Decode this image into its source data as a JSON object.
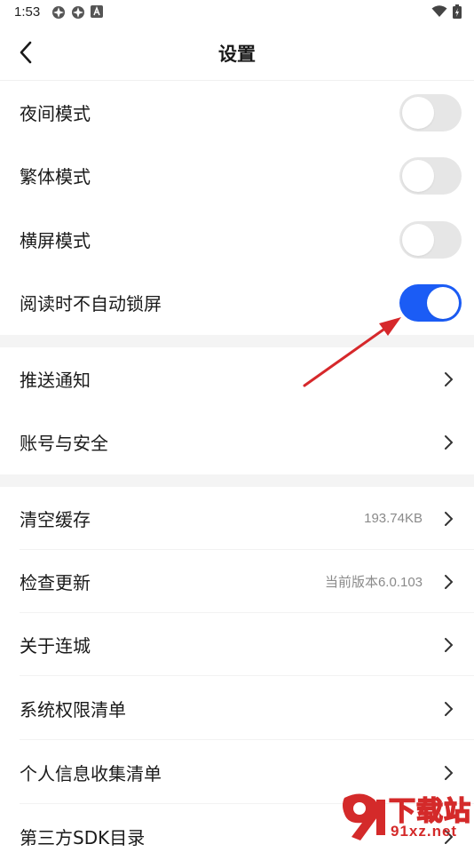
{
  "status_bar": {
    "time": "1:53",
    "left_icons": [
      "app-notification-icon",
      "app-notification-icon",
      "text-icon"
    ],
    "right_icons": [
      "wifi-icon",
      "battery-charging-icon"
    ]
  },
  "header": {
    "title": "设置",
    "back_icon": "chevron-left-icon"
  },
  "toggles": [
    {
      "label": "夜间模式",
      "on": false
    },
    {
      "label": "繁体模式",
      "on": false
    },
    {
      "label": "横屏模式",
      "on": false
    },
    {
      "label": "阅读时不自动锁屏",
      "on": true
    }
  ],
  "group2": [
    {
      "label": "推送通知"
    },
    {
      "label": "账号与安全"
    }
  ],
  "group3": [
    {
      "label": "清空缓存",
      "value": "193.74KB"
    },
    {
      "label": "检查更新",
      "value": "当前版本6.0.103"
    },
    {
      "label": "关于连城",
      "value": ""
    },
    {
      "label": "系统权限清单",
      "value": ""
    },
    {
      "label": "个人信息收集清单",
      "value": ""
    },
    {
      "label": "第三方SDK目录",
      "value": ""
    }
  ],
  "colors": {
    "accent": "#1b5cf5",
    "toggle_off": "#e6e6e6",
    "section_gap": "#f4f4f4",
    "annotation_arrow": "#d6282b"
  },
  "watermark": {
    "text_top": "下载站",
    "text_bottom": "91xz.net"
  }
}
